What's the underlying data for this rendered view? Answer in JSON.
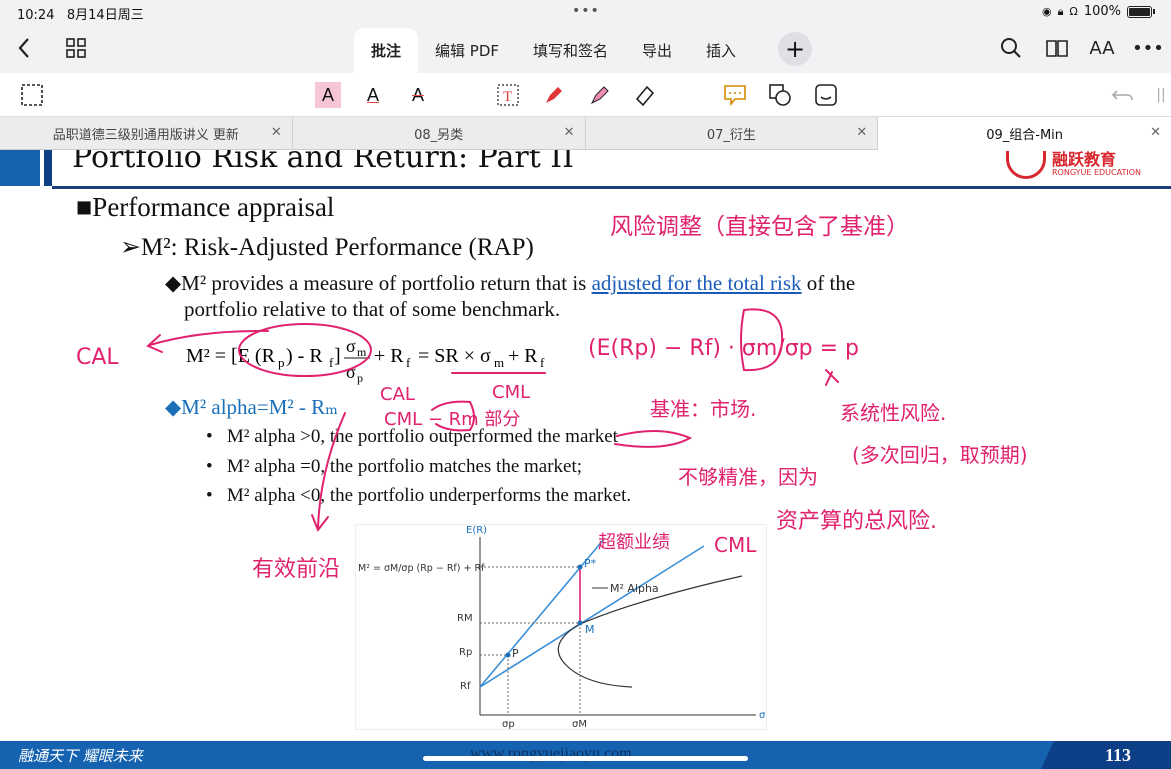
{
  "status": {
    "time": "10:24",
    "date": "8月14日周三",
    "battery": "100%"
  },
  "toolbar": {
    "tabs": [
      {
        "label": "批注",
        "active": true
      },
      {
        "label": "编辑 PDF",
        "active": false
      },
      {
        "label": "填写和签名",
        "active": false
      },
      {
        "label": "导出",
        "active": false
      },
      {
        "label": "插入",
        "active": false
      }
    ],
    "add_label": "+",
    "text_size_label": "AA"
  },
  "doc_tabs": [
    {
      "label": "品职道德三级别通用版讲义 更新",
      "active": false
    },
    {
      "label": "08_另类",
      "active": false
    },
    {
      "label": "07_衍生",
      "active": false
    },
    {
      "label": "09_组合-Min",
      "active": true
    }
  ],
  "slide": {
    "title": "Portfolio Risk and Return: Part II",
    "logo_cn": "融跃教育",
    "logo_en": "RONGYUE EDUCATION",
    "heading": "■Performance appraisal",
    "subheading": "➢M²: Risk-Adjusted Performance (RAP)",
    "point1_a": "◆M² provides a measure of portfolio return that is ",
    "point1_link": "adjusted for the total risk",
    "point1_b": " of the",
    "point1_c": "portfolio relative to that of some benchmark.",
    "formula": "M² = [E(Rₚ) - R_f] σₘ/σₚ + R_f = SR × σₘ + R_f",
    "alpha_def": "◆M² alpha=M² - Rₘ",
    "bullets": [
      "M² alpha >0, the portfolio outperformed the market",
      "M² alpha =0, the portfolio matches the market;",
      "M² alpha <0, the portfolio underperforms the market."
    ],
    "figure": {
      "y_axis": "E(R)",
      "x_axis": "σ",
      "formula_label": "M² = σM/σp (Rp − Rf) + Rf",
      "labels": {
        "p_star": "P*",
        "m2_alpha": "M² Alpha",
        "m": "M",
        "p": "P",
        "rm": "RM",
        "rp": "Rp",
        "rf": "Rf",
        "sigma_p": "σp",
        "sigma_m": "σM"
      }
    },
    "footer_motto": "融通天下 耀眼未来",
    "footer_url": "www.rongyuejiaoyu.com",
    "page_number": "113"
  },
  "handwriting": {
    "risk_adjusted": "风险调整（直接包含了基准）",
    "cal_left": "CAL",
    "formula_note": "(E(Rp) − Rf) · σm/σp = p",
    "cal_under": "CAL",
    "cml_under": "CML",
    "cml_rm": "CML − Rm 部分",
    "benchmark": "基准：市场.",
    "systematic": "系统性风险.",
    "regression": "(多次回归，取预期)",
    "inaccurate": "不够精准，因为",
    "total_risk": "资产算的总风险.",
    "effective_frontier": "有效前沿",
    "excess_perf": "超额业绩",
    "cml_fig": "CML"
  },
  "colors": {
    "ink": "#e0226e",
    "accent_blue": "#1563b0",
    "link_blue": "#1a5bb8"
  }
}
